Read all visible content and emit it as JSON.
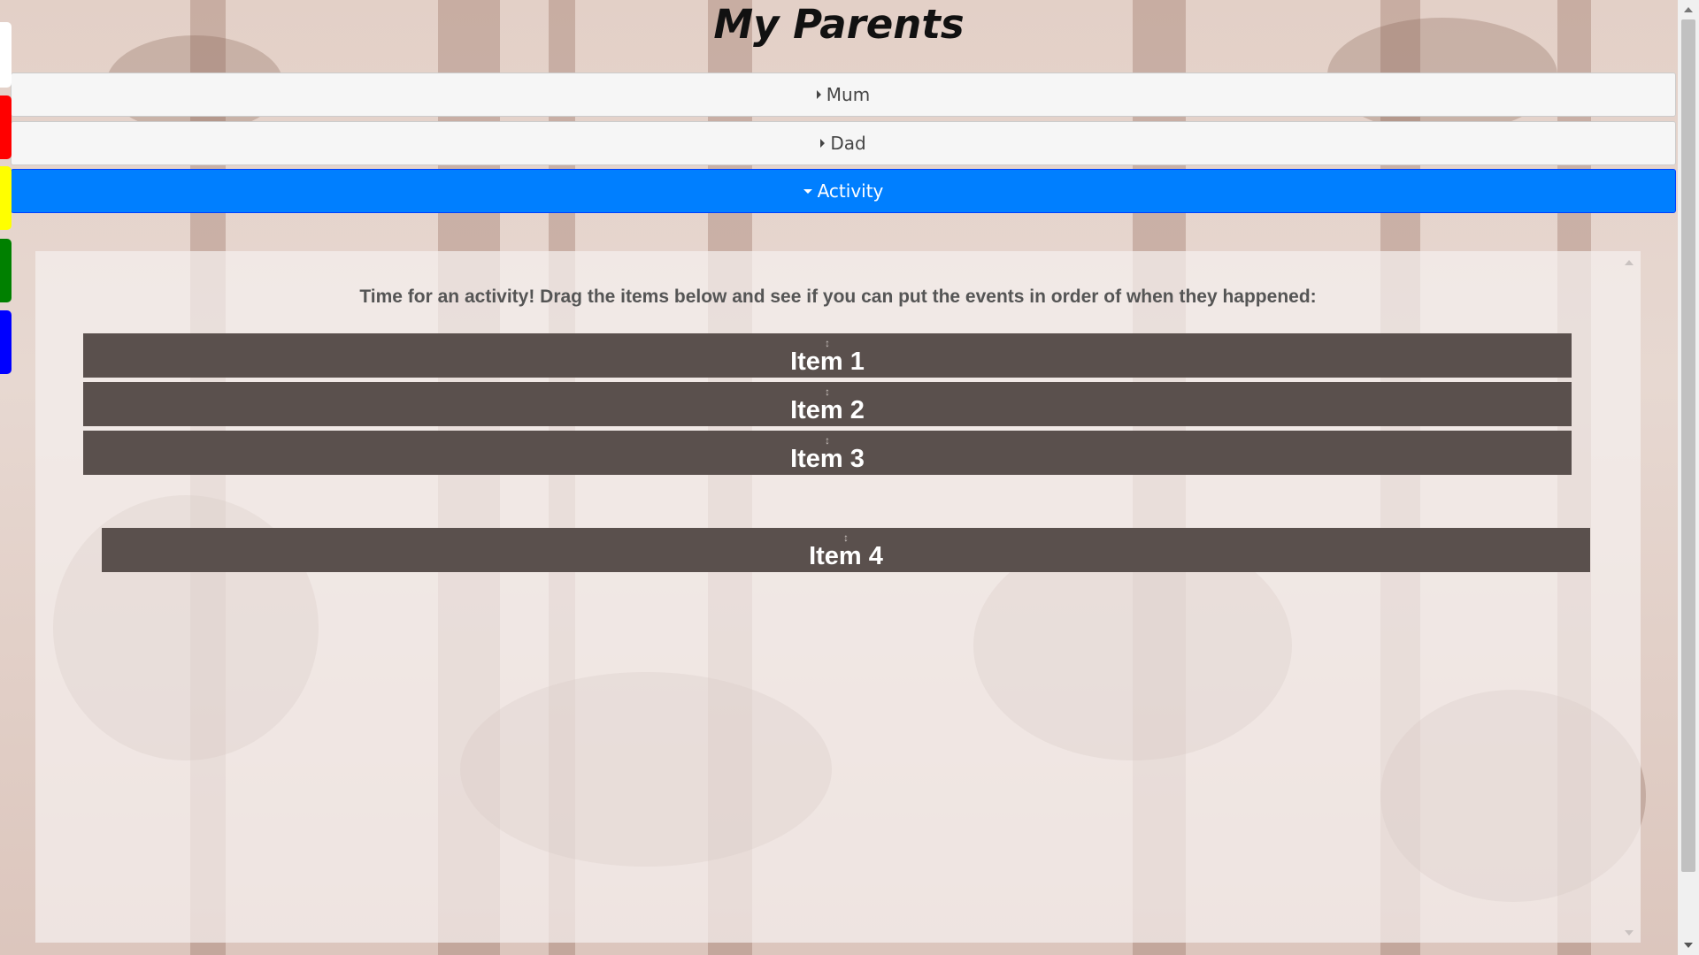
{
  "page": {
    "title": "My Parents"
  },
  "color_tabs": [
    {
      "name": "white",
      "color": "#ffffff"
    },
    {
      "name": "red",
      "color": "#ff0000"
    },
    {
      "name": "yellow",
      "color": "#ffff00"
    },
    {
      "name": "green",
      "color": "#008000"
    },
    {
      "name": "blue",
      "color": "#0000ff"
    }
  ],
  "accordion": {
    "sections": [
      {
        "label": "Mum",
        "expanded": false,
        "icon": "triangle-right-icon"
      },
      {
        "label": "Dad",
        "expanded": false,
        "icon": "triangle-right-icon"
      },
      {
        "label": "Activity",
        "expanded": true,
        "icon": "triangle-down-icon"
      }
    ],
    "active_color": "#007fff"
  },
  "activity": {
    "instruction": "Time for an activity! Drag the items below and see if you can put the events in order of when they happened:",
    "items": [
      {
        "label": "Item 1",
        "grip": "↕"
      },
      {
        "label": "Item 2",
        "grip": "↕"
      },
      {
        "label": "Item 3",
        "grip": "↕"
      },
      {
        "label": "Item 4",
        "grip": "↕"
      }
    ],
    "item_color": "#5a504d"
  }
}
